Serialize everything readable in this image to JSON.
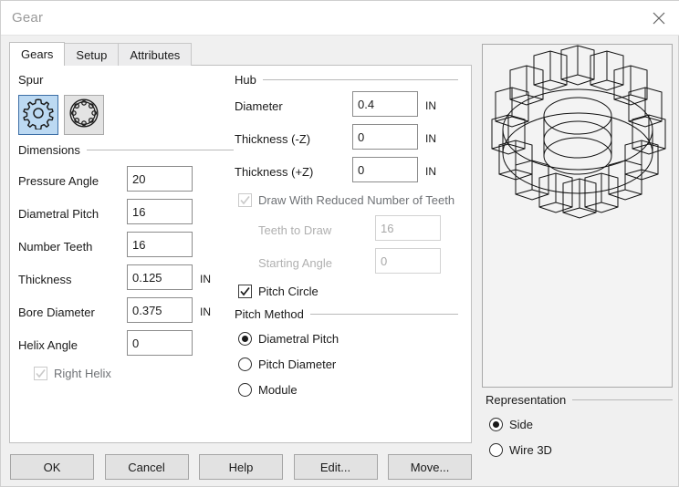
{
  "window": {
    "title": "Gear",
    "close_icon": "close-icon"
  },
  "tabs": [
    {
      "label": "Gears",
      "active": true
    },
    {
      "label": "Setup",
      "active": false
    },
    {
      "label": "Attributes",
      "active": false
    }
  ],
  "spur": {
    "group_label": "Spur",
    "options": [
      {
        "icon": "spur-gear-icon",
        "selected": true
      },
      {
        "icon": "internal-ring-gear-icon",
        "selected": false
      }
    ]
  },
  "dimensions": {
    "group_label": "Dimensions",
    "fields": [
      {
        "label": "Pressure Angle",
        "value": "20",
        "unit": ""
      },
      {
        "label": "Diametral Pitch",
        "value": "16",
        "unit": ""
      },
      {
        "label": "Number Teeth",
        "value": "16",
        "unit": ""
      },
      {
        "label": "Thickness",
        "value": "0.125",
        "unit": "IN"
      },
      {
        "label": "Bore Diameter",
        "value": "0.375",
        "unit": "IN"
      },
      {
        "label": "Helix Angle",
        "value": "0",
        "unit": ""
      }
    ],
    "right_helix": {
      "label": "Right Helix",
      "checked": true,
      "enabled": false
    }
  },
  "hub": {
    "group_label": "Hub",
    "fields": [
      {
        "label": "Diameter",
        "value": "0.4",
        "unit": "IN"
      },
      {
        "label": "Thickness (-Z)",
        "value": "0",
        "unit": "IN"
      },
      {
        "label": "Thickness (+Z)",
        "value": "0",
        "unit": "IN"
      }
    ],
    "reduced_teeth": {
      "label": "Draw With Reduced Number of Teeth",
      "checked": true,
      "enabled": false
    },
    "teeth_to_draw": {
      "label": "Teeth to Draw",
      "value": "16",
      "enabled": false
    },
    "starting_angle": {
      "label": "Starting Angle",
      "value": "0",
      "enabled": false
    },
    "pitch_circle": {
      "label": "Pitch Circle",
      "checked": true,
      "enabled": true
    }
  },
  "pitch_method": {
    "group_label": "Pitch Method",
    "options": [
      {
        "label": "Diametral Pitch",
        "selected": true
      },
      {
        "label": "Pitch Diameter",
        "selected": false
      },
      {
        "label": "Module",
        "selected": false
      }
    ]
  },
  "representation": {
    "group_label": "Representation",
    "options": [
      {
        "label": "Side",
        "selected": true
      },
      {
        "label": "Wire 3D",
        "selected": false
      }
    ]
  },
  "preview": {
    "name": "gear-wireframe-preview"
  },
  "buttons": [
    {
      "label": "OK"
    },
    {
      "label": "Cancel"
    },
    {
      "label": "Help"
    },
    {
      "label": "Edit..."
    },
    {
      "label": "Move..."
    }
  ],
  "colors": {
    "selection": "#bcd9f2",
    "selection_border": "#3c6ea5",
    "dialog_bg": "#f0f0f0",
    "panel_bg": "#ffffff",
    "preview_bg": "#f3f3f3"
  }
}
